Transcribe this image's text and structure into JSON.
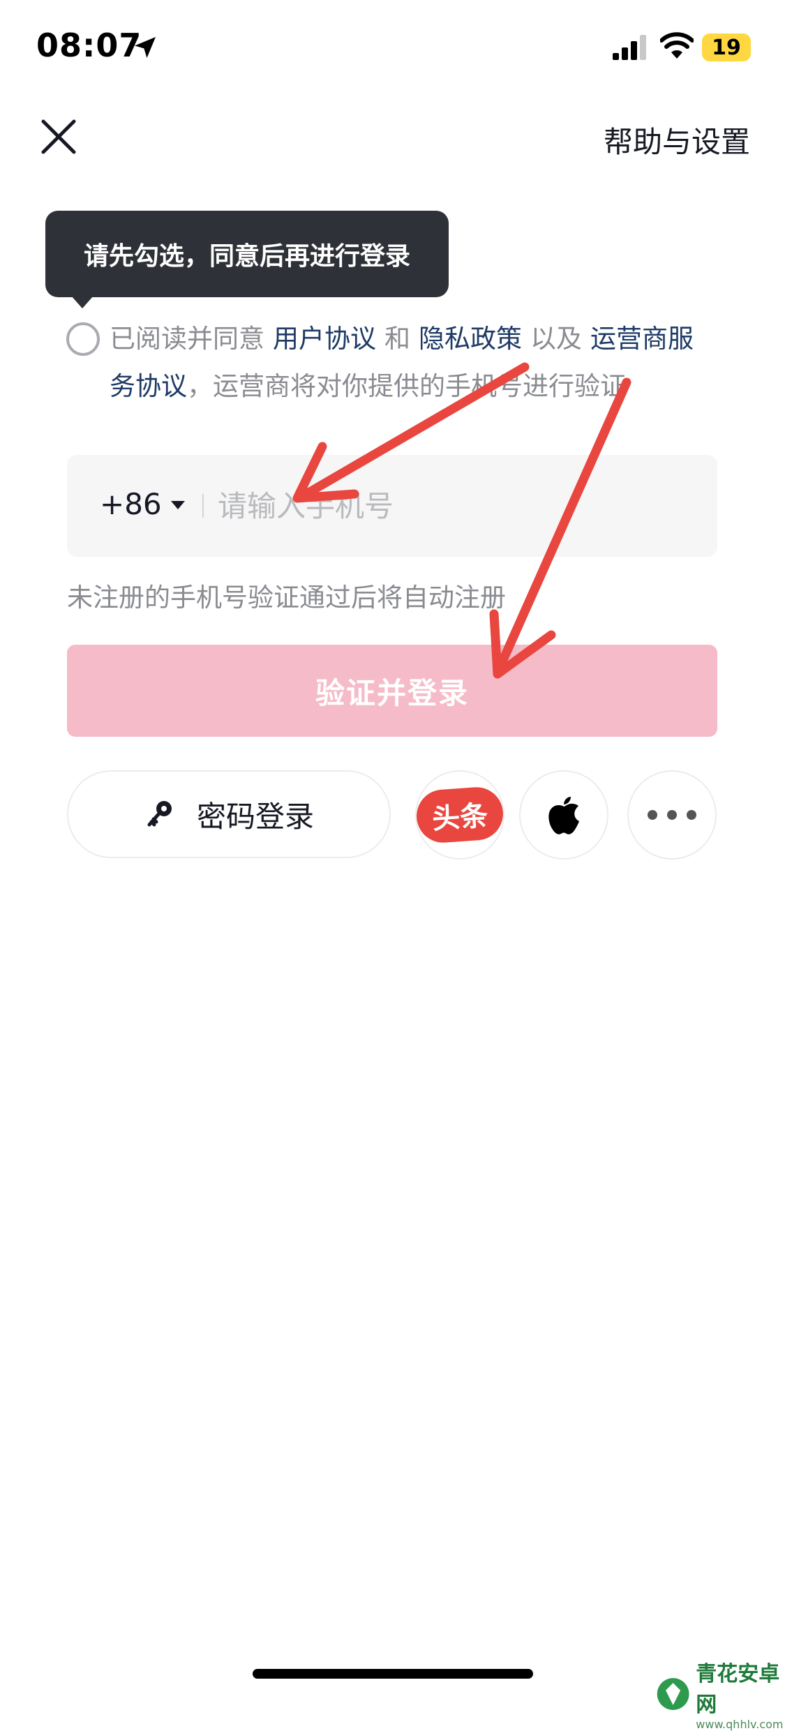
{
  "status_bar": {
    "time": "08:07",
    "battery": "19",
    "icons": [
      "location-arrow-icon",
      "cellular-signal-icon",
      "wifi-icon",
      "battery-icon"
    ]
  },
  "header": {
    "close_icon": "close-icon",
    "help_label": "帮助与设置"
  },
  "tooltip": {
    "text": "请先勾选，同意后再进行登录"
  },
  "agreement": {
    "prefix": "已阅读并同意",
    "user_agreement": "用户协议",
    "and": "和",
    "privacy_policy": "隐私政策",
    "as_well_as": "以及",
    "carrier_agreement": "运营商服务协议",
    "suffix": "，运营商将对你提供的手机号进行验证"
  },
  "phone": {
    "country_code": "+86",
    "placeholder": "请输入手机号",
    "value": ""
  },
  "hint": "未注册的手机号验证通过后将自动注册",
  "login_button": "验证并登录",
  "alt_login": {
    "password_label": "密码登录",
    "toutiao_label": "头条",
    "apple_icon": "apple-icon",
    "more_icon": "more-icon"
  },
  "watermark": {
    "title": "青花安卓网",
    "url": "www.qhhlv.com"
  },
  "colors": {
    "login_button_disabled": "#f5bbc8",
    "link": "#1e3a66",
    "tooltip_bg": "#2f3138",
    "annotation_arrow": "#e8463e",
    "toutiao_red": "#e8463e"
  }
}
